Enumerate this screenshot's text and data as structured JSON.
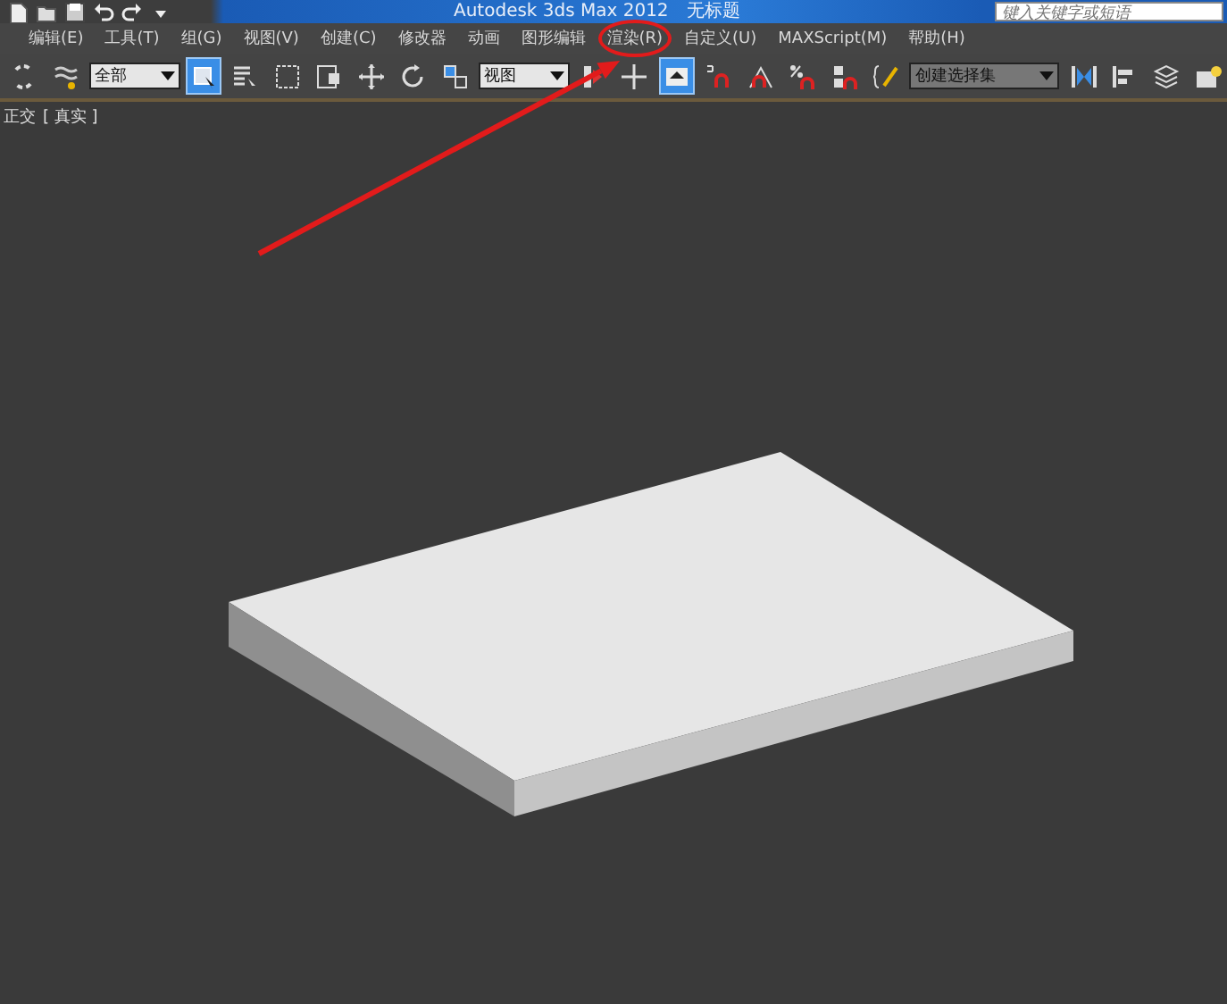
{
  "window": {
    "title": "Autodesk 3ds Max 2012",
    "document": "无标题",
    "search": {
      "placeholder": "键入关键字或短语"
    }
  },
  "menu": [
    {
      "label": "编辑(E)"
    },
    {
      "label": "工具(T)"
    },
    {
      "label": "组(G)"
    },
    {
      "label": "视图(V)"
    },
    {
      "label": "创建(C)"
    },
    {
      "label": "修改器"
    },
    {
      "label": "动画"
    },
    {
      "label": "图形编辑"
    },
    {
      "label": "渲染(R)",
      "circled": true
    },
    {
      "label": "自定义(U)"
    },
    {
      "label": "MAXScript(M)"
    },
    {
      "label": "帮助(H)"
    }
  ],
  "toolbar": [
    {
      "kind": "button",
      "selected": false
    },
    {
      "kind": "button",
      "selected": false
    },
    {
      "kind": "dropdown",
      "value": "全部"
    },
    {
      "kind": "button",
      "selected": true
    },
    {
      "kind": "button",
      "selected": false
    },
    {
      "kind": "button",
      "selected": false
    },
    {
      "kind": "button",
      "selected": false
    },
    {
      "kind": "button",
      "selected": false
    },
    {
      "kind": "button",
      "selected": false
    },
    {
      "kind": "button",
      "selected": false
    },
    {
      "kind": "dropdown",
      "value": "视图"
    },
    {
      "kind": "button",
      "selected": false
    },
    {
      "kind": "button",
      "selected": false
    },
    {
      "kind": "button",
      "selected": true
    },
    {
      "kind": "button",
      "selected": false
    },
    {
      "kind": "button",
      "selected": false
    },
    {
      "kind": "button",
      "selected": false
    },
    {
      "kind": "button",
      "selected": false
    },
    {
      "kind": "button",
      "selected": false
    },
    {
      "kind": "dropdown",
      "value": "创建选择集"
    },
    {
      "kind": "button",
      "selected": false
    },
    {
      "kind": "button",
      "selected": false
    },
    {
      "kind": "button",
      "selected": false
    },
    {
      "kind": "button",
      "selected": false
    }
  ],
  "viewport": {
    "labels": [
      "正交",
      "[ 真实 ]"
    ]
  }
}
